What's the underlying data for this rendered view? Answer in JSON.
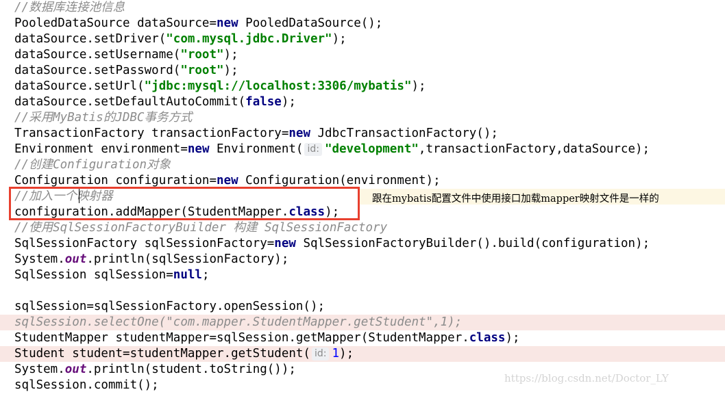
{
  "annotation_text": "跟在mybatis配置文件中使用接口加载mapper映射文件是一样的",
  "watermark_text": "https://blog.csdn.net/Doctor_LY",
  "colors": {
    "comment": "#8c8c8c",
    "keyword": "#000080",
    "string": "#008000",
    "static_field": "#660e7a",
    "number": "#0000ff",
    "red_box": "#e8402f",
    "line_highlight": "#f9e7e4"
  },
  "lines": [
    {
      "hl": "",
      "t": [
        {
          "c": "c",
          "v": "//数据库连接池信息"
        }
      ]
    },
    {
      "hl": "",
      "t": [
        {
          "c": "",
          "v": "PooledDataSource dataSource="
        },
        {
          "c": "k",
          "v": "new"
        },
        {
          "c": "",
          "v": " PooledDataSource();"
        }
      ]
    },
    {
      "hl": "",
      "t": [
        {
          "c": "",
          "v": "dataSource.setDriver("
        },
        {
          "c": "s",
          "v": "\"com.mysql.jdbc.Driver\""
        },
        {
          "c": "",
          "v": ");"
        }
      ]
    },
    {
      "hl": "",
      "t": [
        {
          "c": "",
          "v": "dataSource.setUsername("
        },
        {
          "c": "s",
          "v": "\"root\""
        },
        {
          "c": "",
          "v": ");"
        }
      ]
    },
    {
      "hl": "",
      "t": [
        {
          "c": "",
          "v": "dataSource.setPassword("
        },
        {
          "c": "s",
          "v": "\"root\""
        },
        {
          "c": "",
          "v": ");"
        }
      ]
    },
    {
      "hl": "",
      "t": [
        {
          "c": "",
          "v": "dataSource.setUrl("
        },
        {
          "c": "s",
          "v": "\"jdbc:mysql://localhost:3306/mybatis\""
        },
        {
          "c": "",
          "v": ");"
        }
      ]
    },
    {
      "hl": "",
      "t": [
        {
          "c": "",
          "v": "dataSource.setDefaultAutoCommit("
        },
        {
          "c": "k",
          "v": "false"
        },
        {
          "c": "",
          "v": ");"
        }
      ]
    },
    {
      "hl": "",
      "t": [
        {
          "c": "c",
          "v": "//采用MyBatis的JDBC事务方式"
        }
      ]
    },
    {
      "hl": "",
      "t": [
        {
          "c": "",
          "v": "TransactionFactory transactionFactory="
        },
        {
          "c": "k",
          "v": "new"
        },
        {
          "c": "",
          "v": " JdbcTransactionFactory();"
        }
      ]
    },
    {
      "hl": "",
      "t": [
        {
          "c": "",
          "v": "Environment environment="
        },
        {
          "c": "k",
          "v": "new"
        },
        {
          "c": "",
          "v": " Environment("
        },
        {
          "c": "hint",
          "v": "id:"
        },
        {
          "c": "s",
          "v": "\"development\""
        },
        {
          "c": "",
          "v": ",transactionFactory,dataSource);"
        }
      ]
    },
    {
      "hl": "",
      "t": [
        {
          "c": "c",
          "v": "//创建Configuration对象"
        }
      ]
    },
    {
      "hl": "",
      "t": [
        {
          "c": "",
          "v": "Configuration configuration="
        },
        {
          "c": "k",
          "v": "new"
        },
        {
          "c": "",
          "v": " Configuration(environment);"
        }
      ]
    },
    {
      "hl": "yhl",
      "t": [
        {
          "c": "c",
          "v": "//加入一个映射器"
        }
      ]
    },
    {
      "hl": "",
      "t": [
        {
          "c": "",
          "v": "configuration.addMapper(StudentMapper."
        },
        {
          "c": "k",
          "v": "class"
        },
        {
          "c": "",
          "v": ");"
        }
      ]
    },
    {
      "hl": "",
      "t": [
        {
          "c": "c",
          "v": "//使用SqlSessionFactoryBuilder 构建 SqlSessionFactory"
        }
      ]
    },
    {
      "hl": "",
      "t": [
        {
          "c": "",
          "v": "SqlSessionFactory sqlSessionFactory="
        },
        {
          "c": "k",
          "v": "new"
        },
        {
          "c": "",
          "v": " SqlSessionFactoryBuilder().build(configuration);"
        }
      ]
    },
    {
      "hl": "",
      "t": [
        {
          "c": "",
          "v": "System."
        },
        {
          "c": "f",
          "v": "out"
        },
        {
          "c": "",
          "v": ".println(sqlSessionFactory);"
        }
      ]
    },
    {
      "hl": "",
      "t": [
        {
          "c": "",
          "v": "SqlSession sqlSession="
        },
        {
          "c": "k",
          "v": "null"
        },
        {
          "c": "",
          "v": ";"
        }
      ]
    },
    {
      "hl": "",
      "t": []
    },
    {
      "hl": "",
      "t": [
        {
          "c": "",
          "v": "sqlSession=sqlSessionFactory.openSession();"
        }
      ]
    },
    {
      "hl": "hl",
      "t": [
        {
          "c": "c",
          "v": "sqlSession.selectOne(\"com.mapper.StudentMapper.getStudent\",1);"
        }
      ]
    },
    {
      "hl": "",
      "t": [
        {
          "c": "",
          "v": "StudentMapper studentMapper=sqlSession.getMapper(StudentMapper."
        },
        {
          "c": "k",
          "v": "class"
        },
        {
          "c": "",
          "v": ");"
        }
      ]
    },
    {
      "hl": "hl",
      "t": [
        {
          "c": "",
          "v": "Student student=studentMapper.getStudent("
        },
        {
          "c": "hint",
          "v": "id:"
        },
        {
          "c": "n",
          "v": "1"
        },
        {
          "c": "",
          "v": ");"
        }
      ]
    },
    {
      "hl": "",
      "t": [
        {
          "c": "",
          "v": "System."
        },
        {
          "c": "f",
          "v": "out"
        },
        {
          "c": "",
          "v": ".println(student.toString());"
        }
      ]
    },
    {
      "hl": "",
      "t": [
        {
          "c": "",
          "v": "sqlSession.commit();"
        }
      ]
    }
  ]
}
